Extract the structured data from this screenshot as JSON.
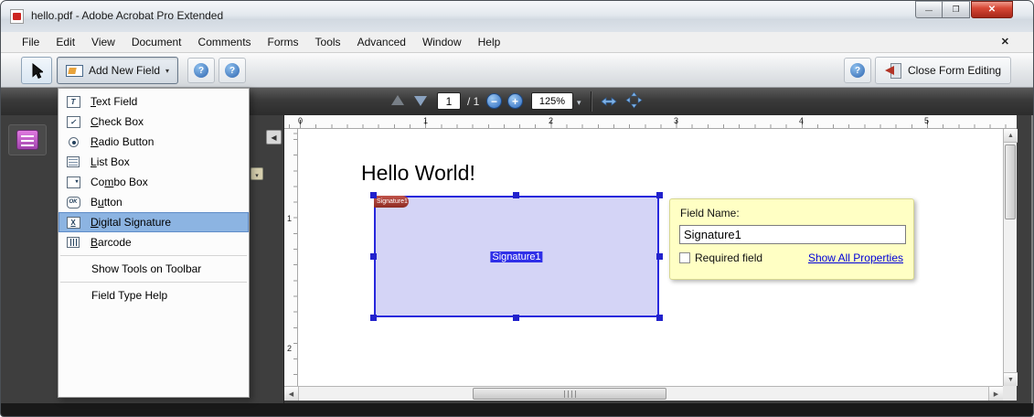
{
  "window": {
    "title": "hello.pdf - Adobe Acrobat Pro Extended"
  },
  "glyphs": {
    "close_x": "✕",
    "minimize": "—",
    "maximize": "❐",
    "help": "?",
    "caret_down": "▾",
    "zoom_out": "−",
    "zoom_in": "+",
    "scroll_up": "▲",
    "scroll_down": "▼",
    "scroll_left": "◀",
    "scroll_right": "▶",
    "collapse_left": "◀",
    "doc_close": "✕"
  },
  "menubar": {
    "items": [
      "File",
      "Edit",
      "View",
      "Document",
      "Comments",
      "Forms",
      "Tools",
      "Advanced",
      "Window",
      "Help"
    ]
  },
  "toolbar": {
    "add_new_field_label": "Add New Field",
    "close_form_editing_label": "Close Form Editing"
  },
  "navbar": {
    "page_current": "1",
    "page_total": "/ 1",
    "zoom_value": "125%"
  },
  "field_menu": {
    "glyphs": {
      "text_field": "T",
      "check": "✓",
      "ok": "OK",
      "signature": "X",
      "combo_caret": "▾"
    },
    "items": [
      {
        "pre": "",
        "accel": "T",
        "post": "ext Field"
      },
      {
        "pre": "",
        "accel": "C",
        "post": "heck Box"
      },
      {
        "pre": "",
        "accel": "R",
        "post": "adio Button"
      },
      {
        "pre": "",
        "accel": "L",
        "post": "ist Box"
      },
      {
        "pre": "Co",
        "accel": "m",
        "post": "bo Box"
      },
      {
        "pre": "B",
        "accel": "u",
        "post": "tton"
      },
      {
        "pre": "",
        "accel": "D",
        "post": "igital Signature"
      },
      {
        "pre": "",
        "accel": "B",
        "post": "arcode"
      }
    ],
    "show_tools_label": "Show Tools on Toolbar",
    "field_type_help_label": "Field Type Help"
  },
  "ruler": {
    "horizontal": [
      "0",
      "1",
      "2",
      "3",
      "4",
      "5"
    ],
    "vertical": [
      "1",
      "2"
    ]
  },
  "page": {
    "heading": "Hello World!",
    "signature_field": {
      "label": "Signature1",
      "tag": "Signature1"
    }
  },
  "popup": {
    "field_name_label": "Field Name:",
    "field_name_value": "Signature1",
    "required_label": "Required field",
    "show_all_properties_label": "Show All Properties"
  },
  "colors": {
    "menu_highlight": "#8cb4e2",
    "field_fill": "#cdcdf5",
    "field_border": "#2828dc",
    "field_label_bg": "#2f2fe8",
    "note_bg": "#ffffc4",
    "link": "#0000d8",
    "zoom_button": "#3f79c8",
    "statusbar": "#191919"
  }
}
